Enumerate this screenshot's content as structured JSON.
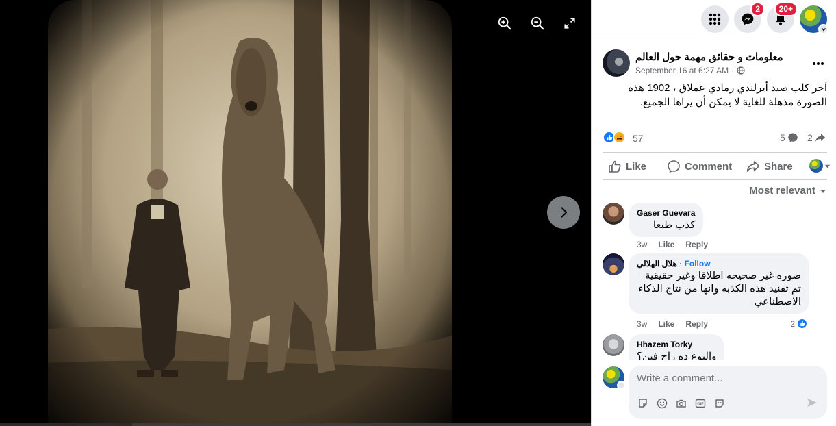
{
  "viewer": {
    "tools": [
      "zoom-in-icon",
      "zoom-out-icon",
      "fullscreen-icon"
    ],
    "next_icon": "chevron-right-icon"
  },
  "topbar": {
    "menu_icon": "grid-menu-icon",
    "messenger_badge": "2",
    "notifications_badge": "20+"
  },
  "post": {
    "page_name": "معلومات و حقائق مهمة حول العالم",
    "timestamp": "September 16 at 6:27 AM",
    "separator": "·",
    "privacy_icon": "globe-icon",
    "text": "آخر كلب صيد أيرلندي رمادي عملاق ، 1902 هذه الصورة مذهلة للغاية لا يمكن أن يراها الجميع.",
    "reaction_count": "57",
    "comment_count": "5",
    "share_count": "2"
  },
  "actions": {
    "like": "Like",
    "comment": "Comment",
    "share": "Share"
  },
  "sort_label": "Most relevant",
  "comments": [
    {
      "author": "Gaser Guevara",
      "follow": "",
      "text": "كذب طبعا",
      "time": "3w",
      "like": "Like",
      "reply": "Reply",
      "reactions": ""
    },
    {
      "author": "هلال الهلالي",
      "follow": "· Follow",
      "text": "صوره غير صحيحه اطلاقا وغير حقيقية تم تفنيد هذه الكذبه وانها من نتاج الذكاء الاصطناعي",
      "time": "3w",
      "like": "Like",
      "reply": "Reply",
      "reactions": "2"
    },
    {
      "author": "Hhazem Torky",
      "follow": "",
      "text": "والنوع ده راح فين؟",
      "time": "",
      "like": "",
      "reply": "",
      "reactions": ""
    }
  ],
  "composer": {
    "placeholder": "Write a comment...",
    "tools": [
      "sticker-icon",
      "emoji-icon",
      "camera-icon",
      "gif-icon",
      "avatar-sticker-icon"
    ],
    "send_icon": "send-icon"
  },
  "colors": {
    "accent": "#1877f2",
    "badge": "#e41e3f",
    "muted": "#65676b",
    "bubble": "#f0f2f5"
  }
}
